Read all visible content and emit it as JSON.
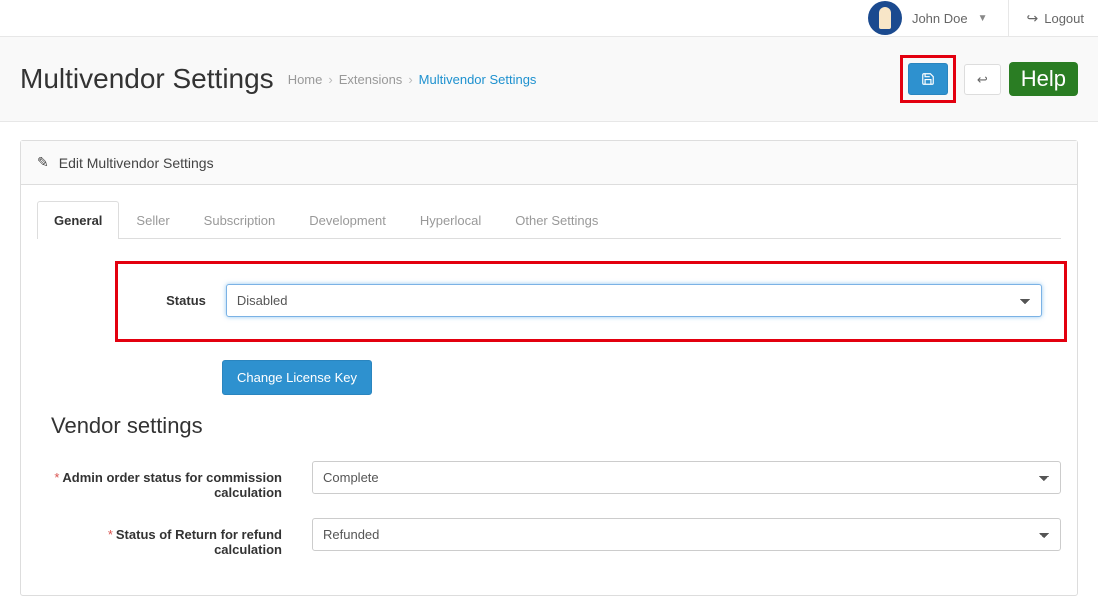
{
  "header": {
    "user_name": "John Doe",
    "logout_label": "Logout"
  },
  "page": {
    "title": "Multivendor Settings",
    "breadcrumb": {
      "home": "Home",
      "extensions": "Extensions",
      "current": "Multivendor Settings"
    },
    "help_label": "Help"
  },
  "panel": {
    "heading": "Edit Multivendor Settings"
  },
  "tabs": [
    {
      "label": "General",
      "active": true
    },
    {
      "label": "Seller",
      "active": false
    },
    {
      "label": "Subscription",
      "active": false
    },
    {
      "label": "Development",
      "active": false
    },
    {
      "label": "Hyperlocal",
      "active": false
    },
    {
      "label": "Other Settings",
      "active": false
    }
  ],
  "form": {
    "status": {
      "label": "Status",
      "value": "Disabled"
    },
    "change_license_label": "Change License Key",
    "section_heading": "Vendor settings",
    "admin_order_status": {
      "label": "Admin order status for commission calculation",
      "value": "Complete"
    },
    "return_status": {
      "label": "Status of Return for refund calculation",
      "value": "Refunded"
    }
  }
}
